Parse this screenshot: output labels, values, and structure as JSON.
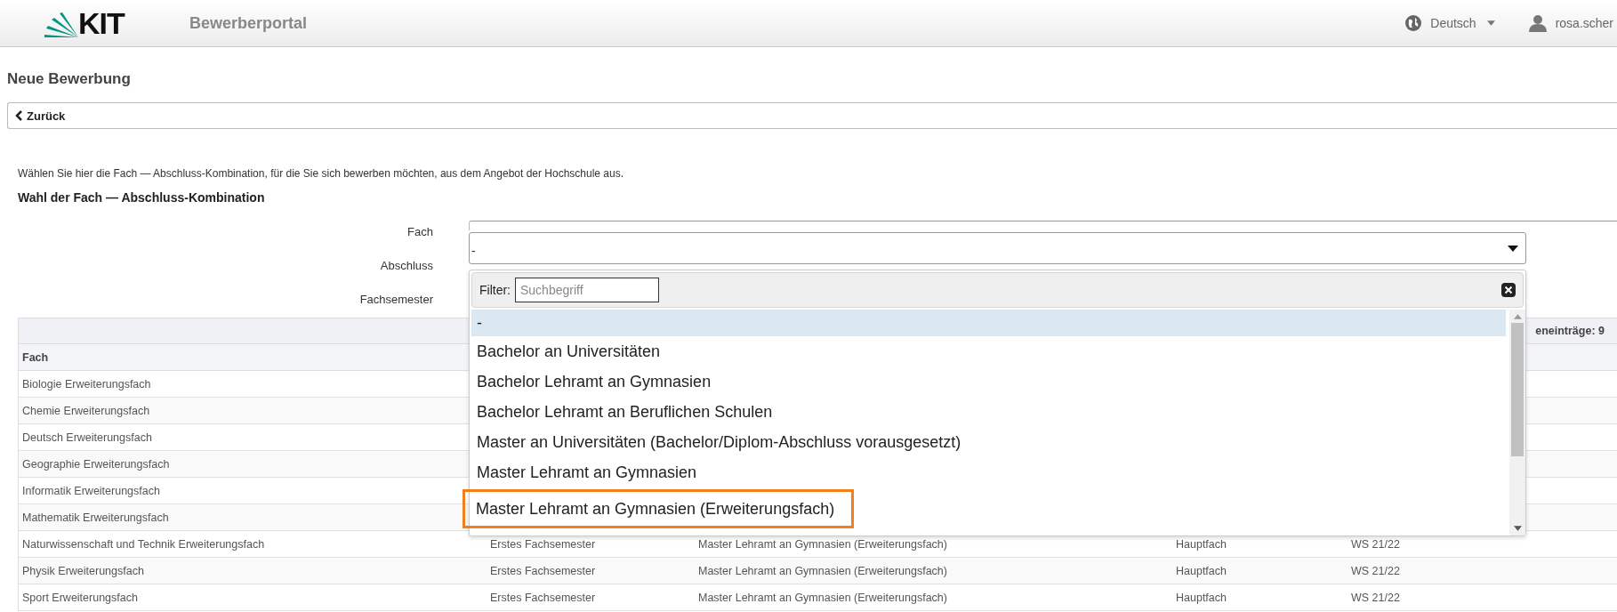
{
  "header": {
    "logo": "KIT",
    "portal_title": "Bewerberportal",
    "language": "Deutsch",
    "user": "rosa.scher"
  },
  "page_title": "Neue Bewerbung",
  "back_button": "Zurück",
  "intro": "Wählen Sie hier die Fach — Abschluss-Kombination, für die Sie sich bewerben möchten, aus dem Angebot der Hochschule aus.",
  "section_title": "Wahl der Fach — Abschluss-Kombination",
  "form": {
    "fields": [
      {
        "label": "Fach"
      },
      {
        "label": "Abschluss",
        "value": "-"
      },
      {
        "label": "Fachsemester"
      }
    ]
  },
  "dropdown": {
    "filter_label": "Filter:",
    "filter_placeholder": "Suchbegriff",
    "options": [
      {
        "label": "-",
        "selected": true,
        "highlighted": false
      },
      {
        "label": "Bachelor an Universitäten",
        "selected": false,
        "highlighted": false
      },
      {
        "label": "Bachelor Lehramt an Gymnasien",
        "selected": false,
        "highlighted": false
      },
      {
        "label": "Bachelor Lehramt an Beruflichen Schulen",
        "selected": false,
        "highlighted": false
      },
      {
        "label": "Master an Universitäten (Bachelor/Diplom-Abschluss vorausgesetzt)",
        "selected": false,
        "highlighted": false
      },
      {
        "label": "Master Lehramt an Gymnasien",
        "selected": false,
        "highlighted": false
      },
      {
        "label": "Master Lehramt an Gymnasien (Erweiterungsfach)",
        "selected": false,
        "highlighted": true
      }
    ]
  },
  "table": {
    "count": "eneinträge: 9",
    "columns": [
      "Fach"
    ],
    "rows": [
      {
        "cells": [
          "Biologie Erweiterungsfach"
        ]
      },
      {
        "cells": [
          "Chemie Erweiterungsfach"
        ]
      },
      {
        "cells": [
          "Deutsch Erweiterungsfach"
        ]
      },
      {
        "cells": [
          "Geographie Erweiterungsfach"
        ]
      },
      {
        "cells": [
          "Informatik Erweiterungsfach"
        ]
      },
      {
        "cells": [
          "Mathematik Erweiterungsfach"
        ]
      },
      {
        "cells": [
          "Naturwissenschaft und Technik Erweiterungsfach",
          "Erstes Fachsemester",
          "Master Lehramt an Gymnasien (Erweiterungsfach)",
          "Hauptfach",
          "WS 21/22"
        ]
      },
      {
        "cells": [
          "Physik Erweiterungsfach",
          "Erstes Fachsemester",
          "Master Lehramt an Gymnasien (Erweiterungsfach)",
          "Hauptfach",
          "WS 21/22"
        ]
      },
      {
        "cells": [
          "Sport Erweiterungsfach",
          "Erstes Fachsemester",
          "Master Lehramt an Gymnasien (Erweiterungsfach)",
          "Hauptfach",
          "WS 21/22"
        ]
      }
    ]
  }
}
